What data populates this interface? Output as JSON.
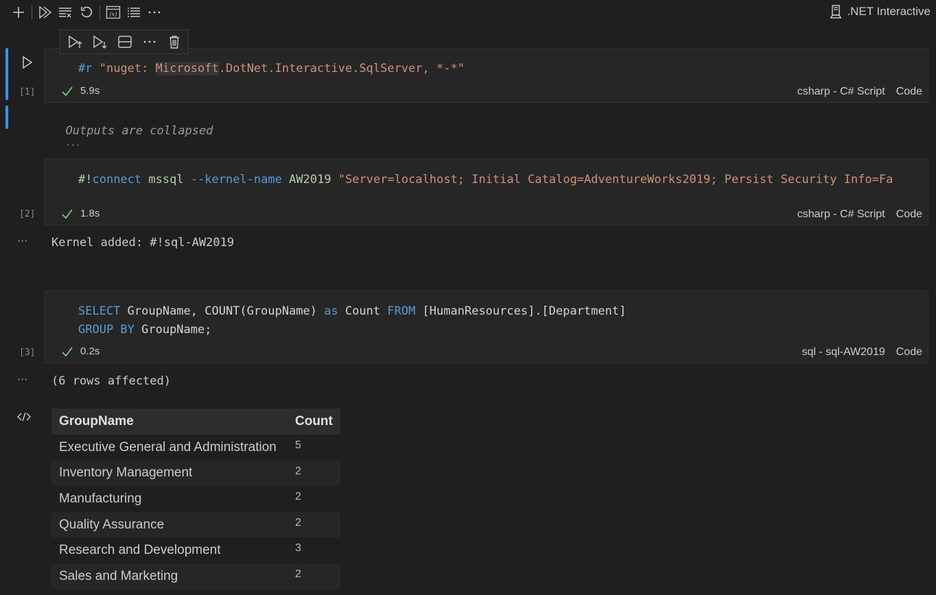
{
  "toolbar": {
    "buttons": [
      {
        "name": "add-cell",
        "icon": "plus-icon"
      },
      {
        "name": "run-all",
        "icon": "run-all-icon"
      },
      {
        "name": "clear-outputs",
        "icon": "clear-all-icon"
      },
      {
        "name": "restart",
        "icon": "restart-icon"
      },
      {
        "name": "variables",
        "icon": "variables-icon"
      },
      {
        "name": "outline",
        "icon": "outline-icon"
      },
      {
        "name": "more",
        "icon": "ellipsis-icon"
      }
    ],
    "kernel_label": ".NET Interactive"
  },
  "cell_toolbar": {
    "buttons": [
      "execute-above",
      "execute-below",
      "split-cell",
      "more",
      "delete"
    ]
  },
  "cells": [
    {
      "exec_count": "[1]",
      "status_time": "5.9s",
      "language": "csharp - C# Script",
      "cell_type": "Code",
      "code": [
        [
          {
            "t": "#r",
            "c": "kw"
          },
          {
            "t": " ",
            "c": "plain"
          },
          {
            "t": "\"nuget: ",
            "c": "str"
          },
          {
            "t": "Microsoft",
            "c": "str hl"
          },
          {
            "t": ".DotNet.Interactive.SqlServer, *-*\"",
            "c": "str"
          }
        ]
      ],
      "output": {
        "collapsed_text": "Outputs are collapsed",
        "collapsed_ellipsis": "···"
      }
    },
    {
      "exec_count": "[2]",
      "status_time": "1.8s",
      "language": "csharp - C# Script",
      "cell_type": "Code",
      "code": [
        [
          {
            "t": "#!",
            "c": "green"
          },
          {
            "t": "connect",
            "c": "kw"
          },
          {
            "t": " ",
            "c": "plain"
          },
          {
            "t": "mssql",
            "c": "green"
          },
          {
            "t": " ",
            "c": "plain"
          },
          {
            "t": "--kernel-name",
            "c": "kw"
          },
          {
            "t": " ",
            "c": "plain"
          },
          {
            "t": "AW2019",
            "c": "green"
          },
          {
            "t": " ",
            "c": "plain"
          },
          {
            "t": "\"Server=localhost; Initial Catalog=AdventureWorks2019; Persist Security Info=Fa",
            "c": "str"
          }
        ]
      ],
      "output": {
        "ellipsis": "···",
        "text": "Kernel added: #!sql-AW2019"
      }
    },
    {
      "exec_count": "[3]",
      "status_time": "0.2s",
      "language": "sql - sql-AW2019",
      "cell_type": "Code",
      "code": [
        [
          {
            "t": "SELECT",
            "c": "kw"
          },
          {
            "t": " GroupName, COUNT(GroupName) ",
            "c": "plain"
          },
          {
            "t": "as",
            "c": "kw"
          },
          {
            "t": " Count ",
            "c": "plain"
          },
          {
            "t": "FROM",
            "c": "kw"
          },
          {
            "t": " [HumanResources].[Department]",
            "c": "plain"
          }
        ],
        [
          {
            "t": "GROUP BY",
            "c": "kw"
          },
          {
            "t": " GroupName;",
            "c": "plain"
          }
        ]
      ],
      "output": {
        "ellipsis": "···",
        "text": "(6 rows affected)",
        "mime_icon": "code-icon",
        "table": {
          "columns": [
            "GroupName",
            "Count"
          ],
          "rows": [
            [
              "Executive General and Administration",
              "5"
            ],
            [
              "Inventory Management",
              "2"
            ],
            [
              "Manufacturing",
              "2"
            ],
            [
              "Quality Assurance",
              "2"
            ],
            [
              "Research and Development",
              "3"
            ],
            [
              "Sales and Marketing",
              "2"
            ]
          ]
        }
      }
    }
  ],
  "colors": {
    "background": "#1f1f1f",
    "cell_background": "#262626",
    "focus_bar": "#3794ff",
    "success_check": "#89d185",
    "keyword": "#569cd6",
    "string": "#ce9178"
  }
}
